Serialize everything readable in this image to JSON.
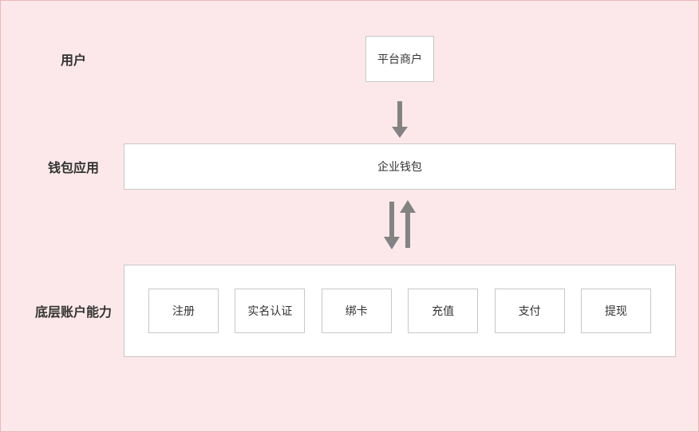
{
  "rows": {
    "user": {
      "label": "用户",
      "box": "平台商户"
    },
    "wallet": {
      "label": "钱包应用",
      "box": "企业钱包"
    },
    "capability": {
      "label": "底层账户能力",
      "items": [
        "注册",
        "实名认证",
        "绑卡",
        "充值",
        "支付",
        "提现"
      ]
    }
  },
  "colors": {
    "background": "#fce8ea",
    "border": "#f0b5bc",
    "boxBorder": "#c8c8c8",
    "arrow": "#838383"
  }
}
